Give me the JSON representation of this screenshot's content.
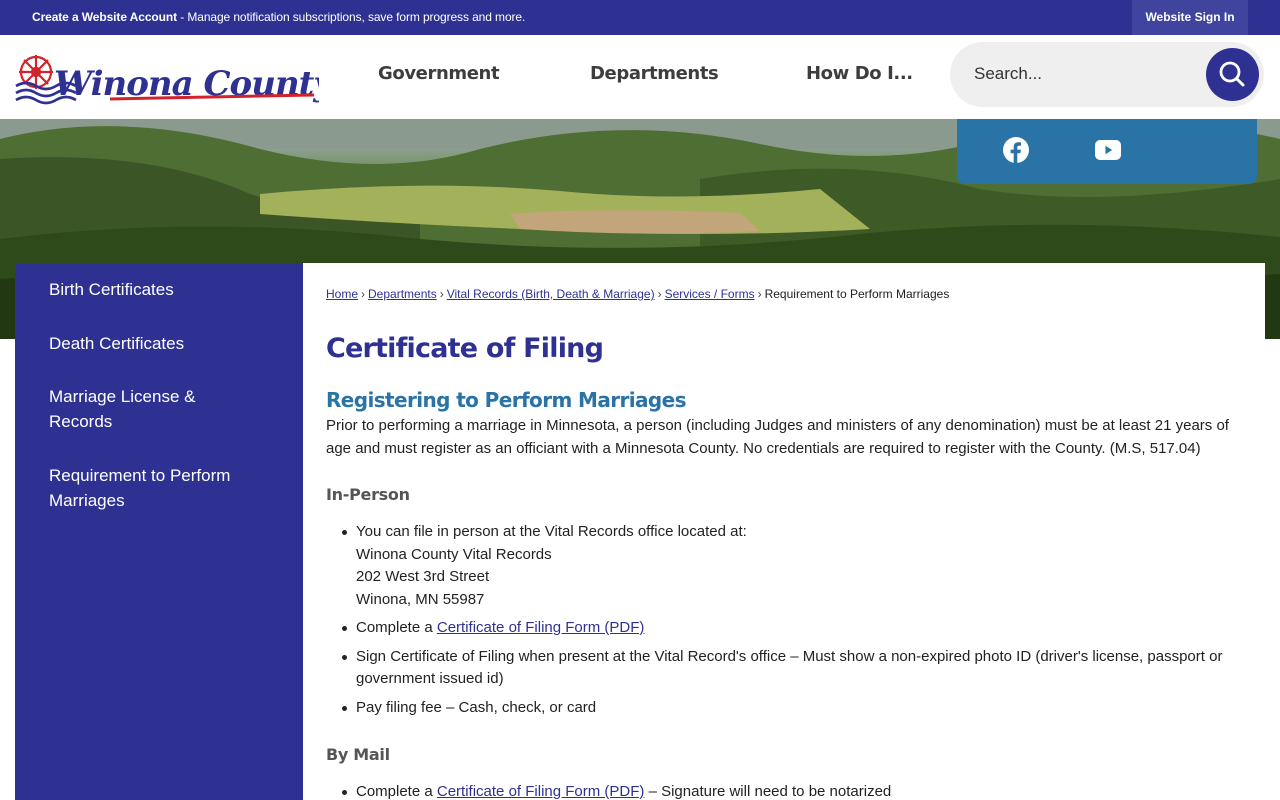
{
  "topbar": {
    "create_account": "Create a Website Account",
    "message": " - Manage notification subscriptions, save form progress and more.",
    "sign_in": "Website Sign In"
  },
  "header": {
    "logo_text": "Winona County",
    "nav": [
      "Government",
      "Departments",
      "How Do I..."
    ],
    "search_placeholder": "Search..."
  },
  "social": {
    "icons": [
      "facebook-icon",
      "youtube-icon"
    ],
    "color": "#2a73a6"
  },
  "sidebar": {
    "items": [
      {
        "label": "Birth Certificates"
      },
      {
        "label": "Death Certificates"
      },
      {
        "label": "Marriage License & Records"
      },
      {
        "label": "Requirement to Perform Marriages"
      }
    ]
  },
  "breadcrumb": {
    "links": [
      "Home",
      "Departments",
      "Vital Records (Birth, Death & Marriage)",
      "Services / Forms"
    ],
    "current": "Requirement to Perform Marriages"
  },
  "main": {
    "title": "Certificate of Filing",
    "subtitle": "Registering to Perform Marriages",
    "intro": "Prior to performing a marriage in Minnesota, a person (including Judges and ministers of any denomination) must be at least 21 years of age and must register as an officiant with a Minnesota County. No credentials are required to register with the County. (M.S, 517.04)",
    "in_person": {
      "heading": "In-Person",
      "item1_lines": [
        "You can file in person at the Vital Records office located at:",
        "Winona County Vital Records",
        "202 West 3rd Street",
        "Winona, MN 55987"
      ],
      "item2_prefix": "Complete a ",
      "item2_link": "Certificate of Filing Form (PDF)",
      "item3": "Sign Certificate of Filing when present at the Vital Record's office – Must show a non-expired photo ID (driver's license, passport or government issued id)",
      "item4": "Pay filing fee – Cash, check, or card"
    },
    "by_mail": {
      "heading": "By Mail",
      "item1_prefix": "Complete a ",
      "item1_link": "Certificate of Filing Form (PDF)",
      "item1_suffix": " – Signature will need to be notarized"
    }
  },
  "colors": {
    "brand": "#2e3192",
    "accent": "#2a73a6",
    "logo_red": "#d2232a"
  }
}
